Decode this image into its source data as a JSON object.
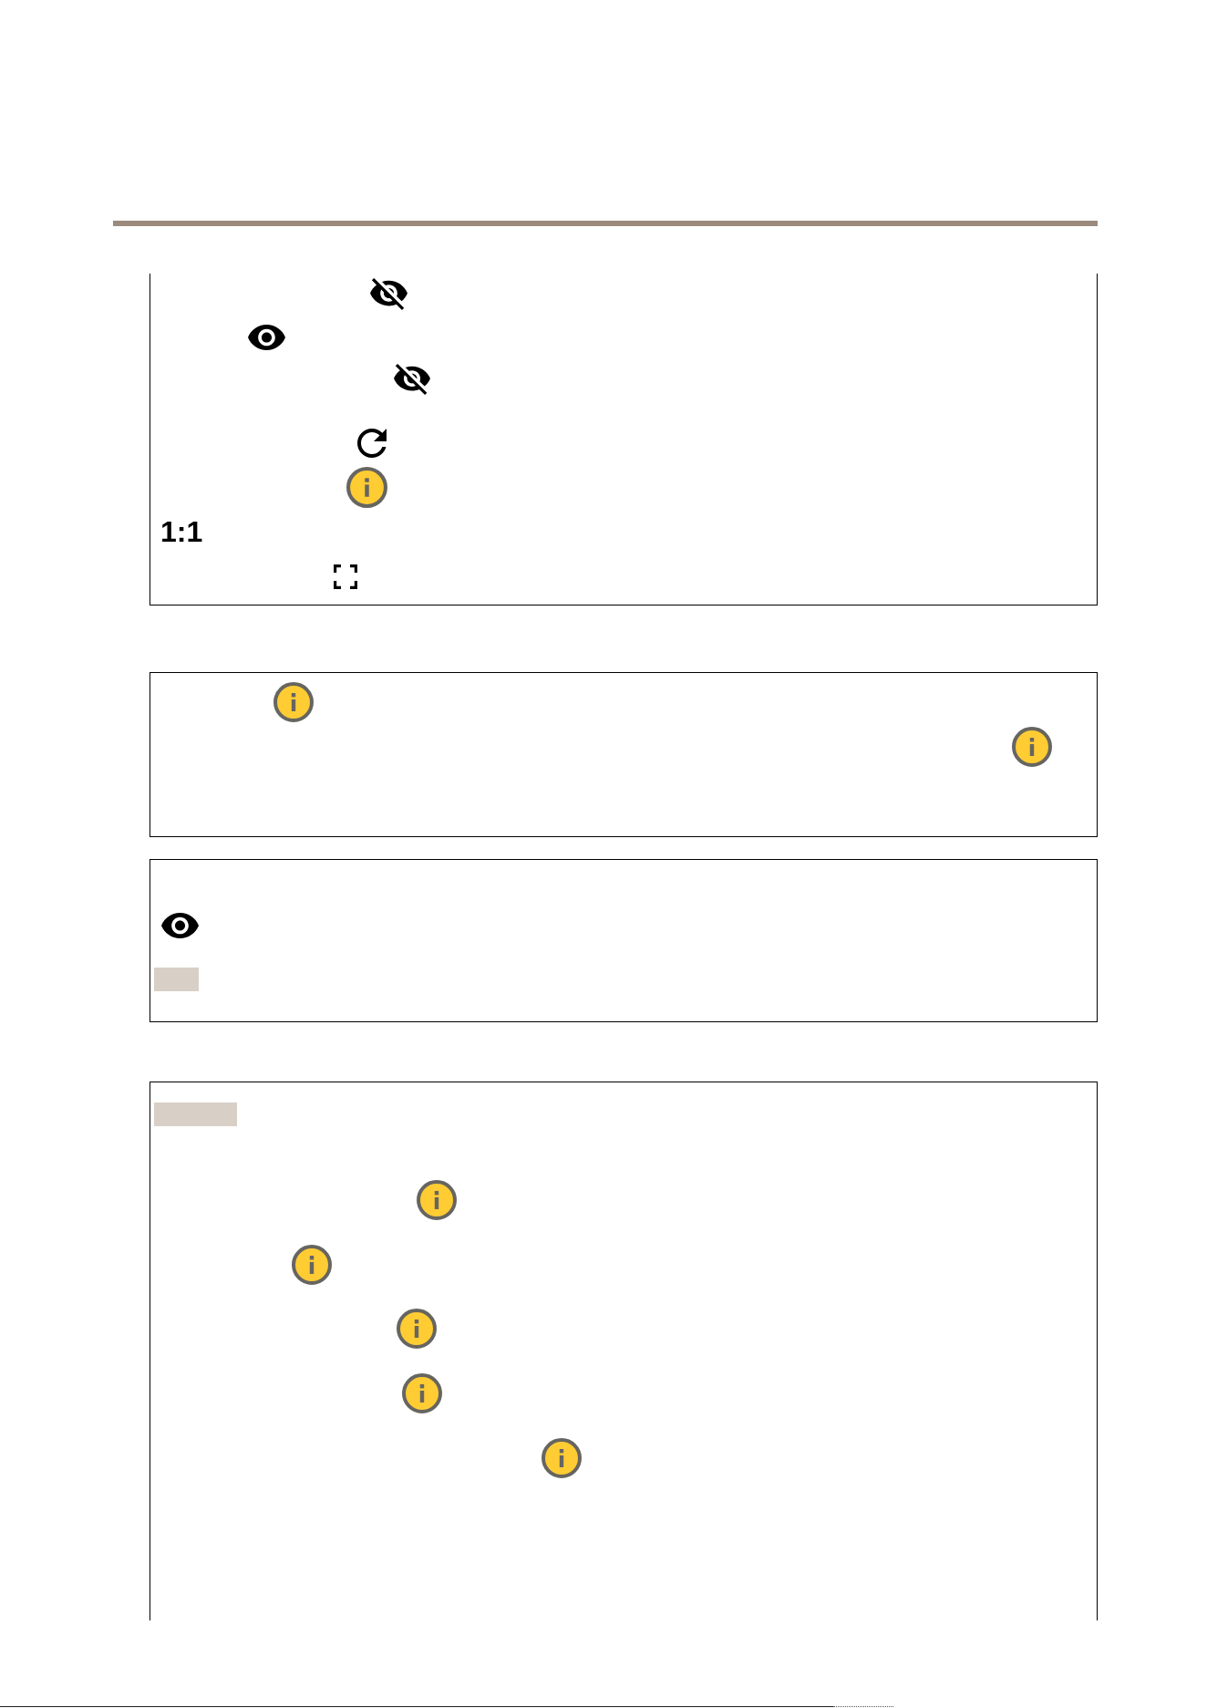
{
  "panel_1": {
    "ratio_label": "1:1"
  }
}
